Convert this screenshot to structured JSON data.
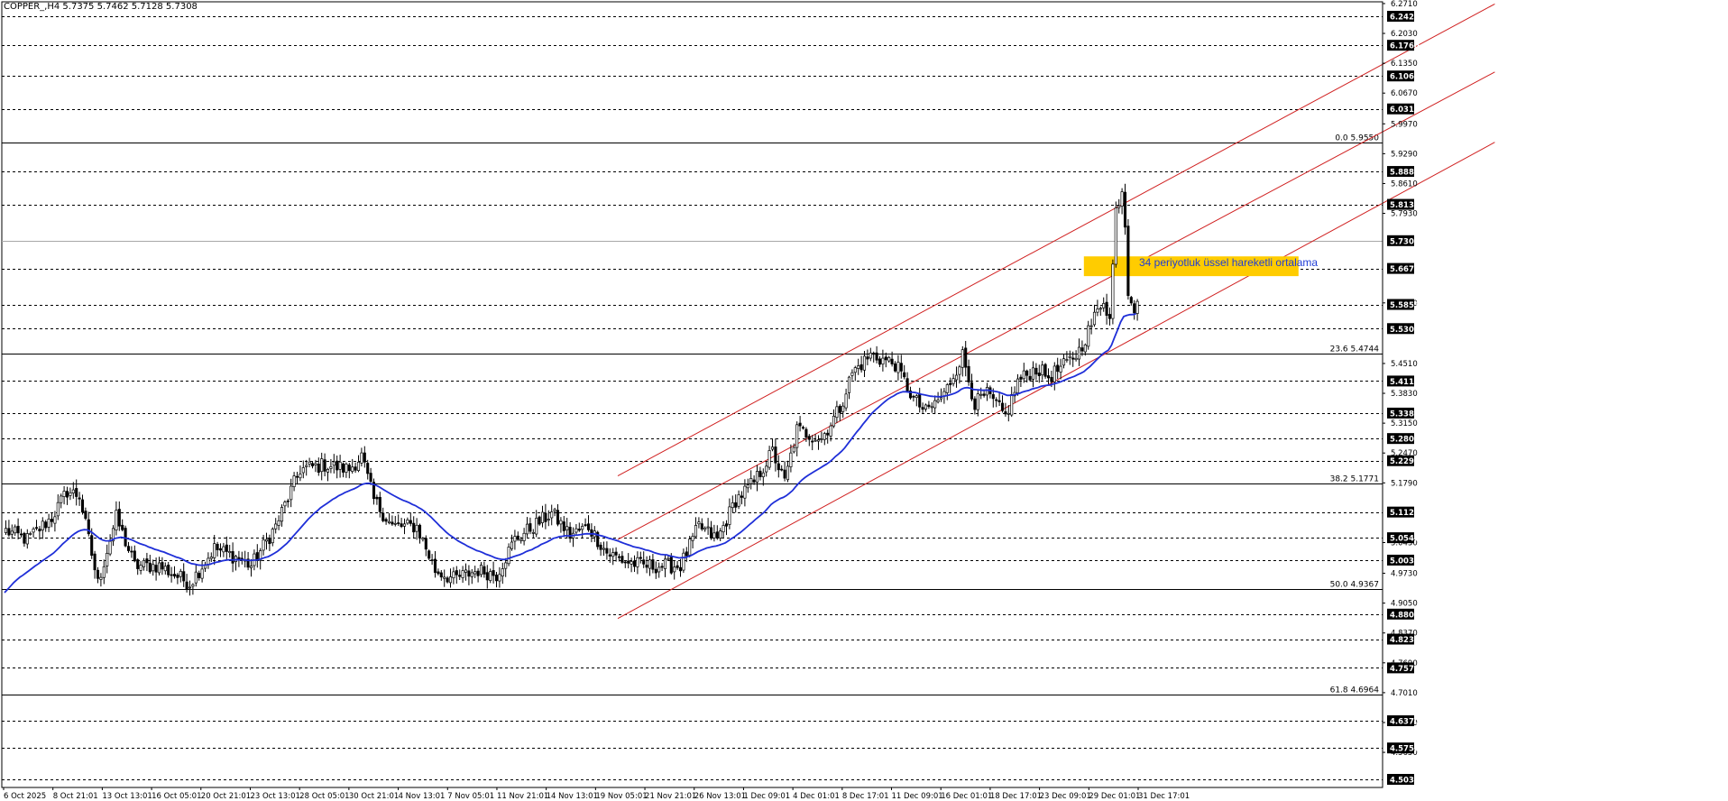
{
  "symbol_line": "COPPER_,H4  5.7375 5.7462 5.7128 5.7308",
  "ema_annotation": "34 periyotluk üssel hareketli ortalama",
  "colors": {
    "candle": "#000000",
    "ema": "#1f2fd8",
    "channel": "#d02020",
    "zone": "#ffcc00",
    "grid": "#000000",
    "label_bg": "#000000",
    "label_text": "#ffffff"
  },
  "chart_data": {
    "type": "candlestick",
    "ylim": [
      4.485,
      6.275
    ],
    "axis_ticks": [
      "6.2710",
      "6.2030",
      "6.1350",
      "6.0670",
      "5.9970",
      "5.9290",
      "5.8610",
      "5.7930",
      "5.5890",
      "5.4510",
      "5.3830",
      "5.3150",
      "5.2470",
      "5.1790",
      "5.0430",
      "4.9730",
      "4.9050",
      "4.8370",
      "4.7690",
      "4.7010",
      "4.6330",
      "4.5650"
    ],
    "levels": [
      {
        "value": 6.242,
        "label": "6.2420",
        "style": "dashed",
        "boxed": true
      },
      {
        "value": 6.176,
        "label": "6.1760",
        "style": "dashed",
        "boxed": true
      },
      {
        "value": 6.106,
        "label": "6.1060",
        "style": "dashed",
        "boxed": true
      },
      {
        "value": 6.031,
        "label": "6.0310",
        "style": "dashed",
        "boxed": true
      },
      {
        "value": 5.8885,
        "label": "5.8885",
        "style": "dashed",
        "boxed": true
      },
      {
        "value": 5.8135,
        "label": "5.8135",
        "style": "dashed",
        "boxed": true
      },
      {
        "value": 5.7308,
        "label": "5.7308",
        "style": "gray",
        "boxed": true
      },
      {
        "value": 5.6675,
        "label": "5.6675",
        "style": "dashed",
        "boxed": true
      },
      {
        "value": 5.5855,
        "label": "5.5855",
        "style": "dashed",
        "boxed": true
      },
      {
        "value": 5.5305,
        "label": "5.5305",
        "style": "dashed",
        "boxed": true
      },
      {
        "value": 5.411,
        "label": "5.4110",
        "style": "dashed",
        "boxed": true
      },
      {
        "value": 5.338,
        "label": "5.3380",
        "style": "dashed",
        "boxed": true
      },
      {
        "value": 5.28,
        "label": "5.2800",
        "style": "dashed",
        "boxed": true
      },
      {
        "value": 5.2295,
        "label": "5.2295",
        "style": "dashed",
        "boxed": true
      },
      {
        "value": 5.1125,
        "label": "5.1125",
        "style": "dashed",
        "boxed": true
      },
      {
        "value": 5.054,
        "label": "5.0540",
        "style": "dashed",
        "boxed": true
      },
      {
        "value": 5.003,
        "label": "5.0030",
        "style": "dashed",
        "boxed": true
      },
      {
        "value": 4.88,
        "label": "4.8800",
        "style": "dashed",
        "boxed": true
      },
      {
        "value": 4.823,
        "label": "4.8230",
        "style": "dashed",
        "boxed": true
      },
      {
        "value": 4.7575,
        "label": "4.7575",
        "style": "dashed",
        "boxed": true
      },
      {
        "value": 4.637,
        "label": "4.6370",
        "style": "dashed",
        "boxed": true
      },
      {
        "value": 4.575,
        "label": "4.5750",
        "style": "dashed",
        "boxed": true
      },
      {
        "value": 4.5035,
        "label": "4.5035",
        "style": "dashed",
        "boxed": true
      }
    ],
    "fibonacci": [
      {
        "value": 5.955,
        "label": "0.0 5.9550"
      },
      {
        "value": 5.4744,
        "label": "23.6 5.4744"
      },
      {
        "value": 5.1771,
        "label": "38.2 5.1771"
      },
      {
        "value": 4.9367,
        "label": "50.0 4.9367"
      },
      {
        "value": 4.6964,
        "label": "61.8 4.6964"
      }
    ],
    "x_labels": [
      "6 Oct 2025",
      "8 Oct 21:01",
      "13 Oct 13:01",
      "16 Oct 05:01",
      "20 Oct 21:01",
      "23 Oct 13:01",
      "28 Oct 05:01",
      "30 Oct 21:01",
      "4 Nov 13:01",
      "7 Nov 05:01",
      "11 Nov 21:01",
      "14 Nov 13:01",
      "19 Nov 05:01",
      "21 Nov 21:01",
      "26 Nov 13:01",
      "1 Dec 09:01",
      "4 Dec 01:01",
      "8 Dec 17:01",
      "11 Dec 09:01",
      "16 Dec 01:01",
      "18 Dec 17:01",
      "23 Dec 09:01",
      "29 Dec 01:01",
      "31 Dec 17:01"
    ],
    "bar_count": 370,
    "close_path": [
      [
        0,
        5.07
      ],
      [
        7,
        5.05
      ],
      [
        15,
        5.1
      ],
      [
        20,
        5.16
      ],
      [
        24,
        5.15
      ],
      [
        30,
        4.95
      ],
      [
        36,
        5.1
      ],
      [
        42,
        4.99
      ],
      [
        50,
        4.99
      ],
      [
        60,
        4.95
      ],
      [
        68,
        5.03
      ],
      [
        75,
        5.01
      ],
      [
        80,
        4.99
      ],
      [
        88,
        5.08
      ],
      [
        96,
        5.21
      ],
      [
        104,
        5.22
      ],
      [
        112,
        5.21
      ],
      [
        116,
        5.24
      ],
      [
        120,
        5.14
      ],
      [
        126,
        5.08
      ],
      [
        134,
        5.08
      ],
      [
        140,
        4.98
      ],
      [
        146,
        4.96
      ],
      [
        154,
        4.98
      ],
      [
        160,
        4.97
      ],
      [
        166,
        5.05
      ],
      [
        172,
        5.08
      ],
      [
        178,
        5.11
      ],
      [
        184,
        5.06
      ],
      [
        190,
        5.08
      ],
      [
        196,
        5.02
      ],
      [
        202,
        5.0
      ],
      [
        208,
        4.99
      ],
      [
        214,
        4.99
      ],
      [
        220,
        4.99
      ],
      [
        226,
        5.08
      ],
      [
        232,
        5.05
      ],
      [
        238,
        5.14
      ],
      [
        244,
        5.18
      ],
      [
        250,
        5.25
      ],
      [
        254,
        5.18
      ],
      [
        258,
        5.3
      ],
      [
        266,
        5.28
      ],
      [
        272,
        5.35
      ],
      [
        276,
        5.43
      ],
      [
        282,
        5.47
      ],
      [
        290,
        5.45
      ],
      [
        296,
        5.37
      ],
      [
        300,
        5.34
      ],
      [
        306,
        5.38
      ],
      [
        312,
        5.47
      ],
      [
        316,
        5.36
      ],
      [
        320,
        5.38
      ],
      [
        326,
        5.33
      ],
      [
        330,
        5.41
      ],
      [
        336,
        5.44
      ],
      [
        340,
        5.42
      ],
      [
        346,
        5.45
      ],
      [
        350,
        5.48
      ],
      [
        354,
        5.54
      ],
      [
        358,
        5.6
      ],
      [
        360,
        5.55
      ],
      [
        362,
        5.8
      ],
      [
        364,
        5.85
      ],
      [
        365,
        5.77
      ],
      [
        366,
        5.62
      ],
      [
        368,
        5.58
      ],
      [
        370,
        5.62
      ],
      [
        372,
        5.65
      ],
      [
        374,
        5.7
      ],
      [
        376,
        5.72
      ],
      [
        378,
        5.68
      ],
      [
        380,
        5.7
      ],
      [
        382,
        5.71
      ],
      [
        384,
        5.74
      ],
      [
        386,
        5.731
      ]
    ],
    "ema_period": 34,
    "ema_seed": 4.92,
    "channel": {
      "start_bar": 200,
      "end_bar": 486,
      "lines": [
        {
          "name": "upper",
          "start": 5.195,
          "end": 6.27
        },
        {
          "name": "middle",
          "start": 5.05,
          "end": 6.115
        },
        {
          "name": "lower",
          "start": 4.87,
          "end": 5.955
        }
      ]
    },
    "zone": {
      "bar_start": 352,
      "bar_end": 422,
      "low": 5.65,
      "high": 5.695
    },
    "ema_annotation_text": "34 periyotluk üssel hareketli ortalama"
  }
}
